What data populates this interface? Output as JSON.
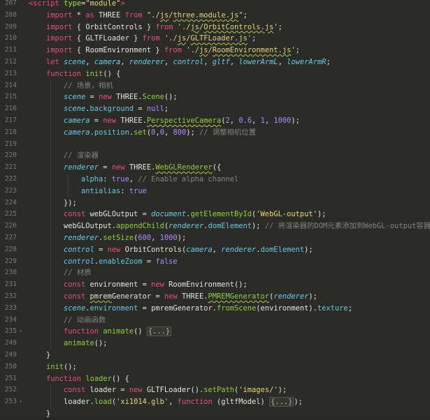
{
  "editor": {
    "current_line": 251,
    "lines": [
      {
        "n": "207",
        "fold": false,
        "indent": 0,
        "html": "<span class=\"tg\">&lt;script</span> <span class=\"at\">type</span>=<span class=\"st\">\"module\"</span><span class=\"tg\">&gt;</span>"
      },
      {
        "n": "208",
        "fold": false,
        "indent": 1,
        "html": "<span class=\"kw\">import</span> * <span class=\"kw\">as</span> THREE <span class=\"kw\">from</span> <span class=\"st\">\"./<span class=\"ul\">js</span>/<span class=\"ul\">three.module.js</span>\"</span>;"
      },
      {
        "n": "209",
        "fold": false,
        "indent": 1,
        "html": "<span class=\"kw\">import</span> { OrbitControls } <span class=\"kw\">from</span> <span class=\"st\">'./<span class=\"ul\">js</span>/<span class=\"ul\">OrbitControls.js</span>'</span>;"
      },
      {
        "n": "210",
        "fold": false,
        "indent": 1,
        "html": "<span class=\"kw\">import</span> { GLTFLoader } <span class=\"kw\">from</span> <span class=\"st\">'./<span class=\"ul\">js</span>/<span class=\"ul\">GLTFLoader.js</span>'</span>;"
      },
      {
        "n": "211",
        "fold": false,
        "indent": 1,
        "html": "<span class=\"kw\">import</span> { RoomEnvironment } <span class=\"kw\">from</span> <span class=\"st\">'./<span class=\"ul\">js</span>/<span class=\"ul\">RoomEnvironment.js</span>'</span>;"
      },
      {
        "n": "212",
        "fold": false,
        "indent": 1,
        "html": "<span class=\"kw\">let</span> <span class=\"va\">scene</span>, <span class=\"va\">camera</span>, <span class=\"va\">renderer</span>, <span class=\"va\">control</span>, <span class=\"va\">gltf</span>, <span class=\"va\">lowerArmL</span>, <span class=\"va\">lowerArmR</span>;"
      },
      {
        "n": "213",
        "fold": false,
        "indent": 1,
        "html": "<span class=\"kw\">function</span> <span class=\"fn\">init</span>() {"
      },
      {
        "n": "214",
        "fold": false,
        "indent": 2,
        "html": "<span class=\"cm\">// 场景，相机</span>"
      },
      {
        "n": "215",
        "fold": false,
        "indent": 2,
        "html": "<span class=\"va\">scene</span> = <span class=\"kw\">new</span> THREE.<span class=\"fn\">Scene</span>();"
      },
      {
        "n": "216",
        "fold": false,
        "indent": 2,
        "html": "<span class=\"va\">scene</span>.<span class=\"pr\">background</span> = <span class=\"nu\">null</span>;"
      },
      {
        "n": "217",
        "fold": false,
        "indent": 2,
        "html": "<span class=\"va\">camera</span> = <span class=\"kw\">new</span> THREE.<span class=\"fn ul\">PerspectiveCamera</span>(<span class=\"nu\">2</span>, <span class=\"nu\">0.6</span>, <span class=\"nu\">1</span>, <span class=\"nu\">1000</span>);"
      },
      {
        "n": "218",
        "fold": false,
        "indent": 2,
        "html": "<span class=\"va\">camera</span>.<span class=\"pr\">position</span>.<span class=\"fn\">set</span>(<span class=\"nu\">0</span>,<span class=\"nu\">0</span>, <span class=\"nu\">800</span>); <span class=\"cm\">// 调整相机位置</span>"
      },
      {
        "n": "219",
        "fold": false,
        "indent": 2,
        "html": ""
      },
      {
        "n": "220",
        "fold": false,
        "indent": 2,
        "html": "<span class=\"cm\">// 渲染器</span>"
      },
      {
        "n": "221",
        "fold": false,
        "indent": 2,
        "html": "<span class=\"va\">renderer</span> = <span class=\"kw\">new</span> THREE.<span class=\"fn ul\">WebGLRenderer</span>({"
      },
      {
        "n": "222",
        "fold": false,
        "indent": 3,
        "html": "<span class=\"pr\">alpha</span>: <span class=\"nu\">true</span>, <span class=\"cm\">// Enable alpha channel</span>"
      },
      {
        "n": "223",
        "fold": false,
        "indent": 3,
        "html": "<span class=\"pr\">antialias</span>: <span class=\"nu\">true</span>"
      },
      {
        "n": "224",
        "fold": false,
        "indent": 2,
        "html": "});"
      },
      {
        "n": "225",
        "fold": false,
        "indent": 2,
        "html": "<span class=\"kw\">const</span> webGLOutput = <span class=\"va\">document</span>.<span class=\"fn\">getElementById</span>(<span class=\"st\">'WebGL-output'</span>);"
      },
      {
        "n": "226",
        "fold": false,
        "indent": 2,
        "html": "webGLOutput.<span class=\"fn\">appendChild</span>(<span class=\"va\">renderer</span>.<span class=\"pr\">domElement</span>); <span class=\"cm\">// 将渲染器的DOM元素添加到WebGL-output容器中</span>"
      },
      {
        "n": "227",
        "fold": false,
        "indent": 2,
        "html": "<span class=\"va\">renderer</span>.<span class=\"fn\">setSize</span>(<span class=\"nu\">600</span>, <span class=\"nu\">1000</span>);"
      },
      {
        "n": "228",
        "fold": false,
        "indent": 2,
        "html": "<span class=\"va\">control</span> = <span class=\"kw\">new</span> OrbitControls(<span class=\"va\">camera</span>, <span class=\"va\">renderer</span>.<span class=\"pr\">domElement</span>);"
      },
      {
        "n": "229",
        "fold": false,
        "indent": 2,
        "html": "<span class=\"va\">control</span>.<span class=\"pr\">enableZoom</span> = <span class=\"nu\">false</span>"
      },
      {
        "n": "230",
        "fold": false,
        "indent": 2,
        "html": "<span class=\"cm\">// 材质</span>"
      },
      {
        "n": "231",
        "fold": false,
        "indent": 2,
        "html": "<span class=\"kw\">const</span> environment = <span class=\"kw\">new</span> RoomEnvironment();"
      },
      {
        "n": "232",
        "fold": false,
        "indent": 2,
        "html": "<span class=\"kw\">const</span> <span class=\"ul\">pmrem</span>Generator = <span class=\"kw\">new</span> THREE.<span class=\"fn ul\">PMREMGenerator</span>(<span class=\"va\">renderer</span>);"
      },
      {
        "n": "233",
        "fold": false,
        "indent": 2,
        "html": "<span class=\"va\">scene</span>.<span class=\"pr\">environment</span> = pmremGenerator.<span class=\"fn\">fromScene</span>(environment).<span class=\"pr\">texture</span>;"
      },
      {
        "n": "234",
        "fold": false,
        "indent": 2,
        "html": "<span class=\"cm\">// 动画函数</span>"
      },
      {
        "n": "235",
        "fold": true,
        "indent": 2,
        "html": "<span class=\"kw\">function</span> <span class=\"fn\">animate</span>() <span class=\"fd\">{...}</span>"
      },
      {
        "n": "249",
        "fold": false,
        "indent": 2,
        "html": "<span class=\"fn\">animate</span>();"
      },
      {
        "n": "249",
        "fold": false,
        "indent": 1,
        "html": "}"
      },
      {
        "n": "250",
        "fold": false,
        "indent": 1,
        "html": "<span class=\"fn\">init</span>();"
      },
      {
        "n": "251",
        "fold": false,
        "indent": 1,
        "html": "<span class=\"kw\">function</span> <span class=\"fn\">loader</span>() {"
      },
      {
        "n": "252",
        "fold": false,
        "indent": 2,
        "html": "<span class=\"kw\">const</span> loader = <span class=\"kw\">new</span> GLTFLoader().<span class=\"fn\">setPath</span>(<span class=\"st\">'images/'</span>);"
      },
      {
        "n": "253",
        "fold": true,
        "indent": 2,
        "html": "loader.<span class=\"fn\">load</span>(<span class=\"st\">'xi1014.glb'</span>, <span class=\"kw\">function</span> (gltfModel) <span class=\"fd\">{...}</span>);"
      },
      {
        "n": "",
        "fold": false,
        "indent": 1,
        "html": "}"
      }
    ]
  }
}
